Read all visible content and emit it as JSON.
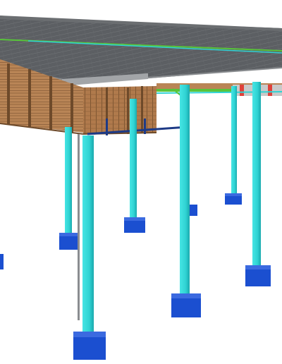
{
  "scene": {
    "kind": "3d-structural-model-render",
    "description_visible_text": "",
    "colors": {
      "background": "#ffffff",
      "roof": "#5c5f63",
      "roof_edge": "#8a8d90",
      "columns": "#2fd3d3",
      "column_shade": "#1aa9ad",
      "footings": "#1b4fd0",
      "footing_shade": "#123a9e",
      "timber": "#a5764a",
      "timber_dark": "#6e4a2a",
      "beam_green": "#58c43a",
      "beam_red": "#e0413a",
      "tie_beam": "#1d3a86"
    },
    "icons": []
  }
}
